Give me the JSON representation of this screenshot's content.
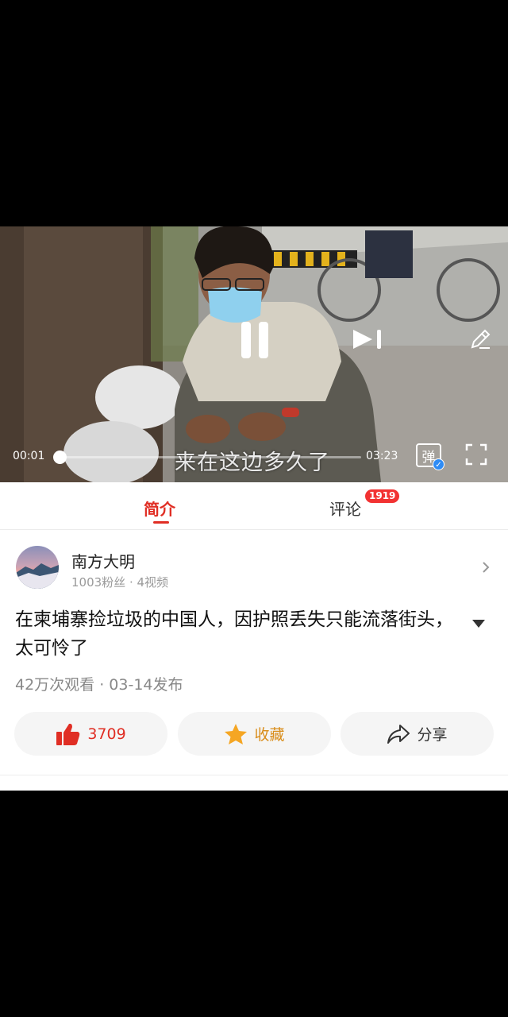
{
  "video": {
    "subtitle": "来在这边多久了",
    "current_time": "00:01",
    "total_time": "03:23",
    "progress": 0.005,
    "danmu_label": "弹"
  },
  "tabs": {
    "intro": "简介",
    "comments": "评论",
    "comments_badge": "1919"
  },
  "author": {
    "name": "南方大明",
    "meta": "1003粉丝 · 4视频"
  },
  "post": {
    "title": "在柬埔寨捡垃圾的中国人，因护照丢失只能流落街头，太可怜了",
    "stats": "42万次观看 · 03-14发布"
  },
  "actions": {
    "like_count": "3709",
    "favorite_label": "收藏",
    "share_label": "分享"
  },
  "colors": {
    "accent": "#e02e24",
    "favorite": "#d98d1a",
    "badge": "#f23232"
  }
}
